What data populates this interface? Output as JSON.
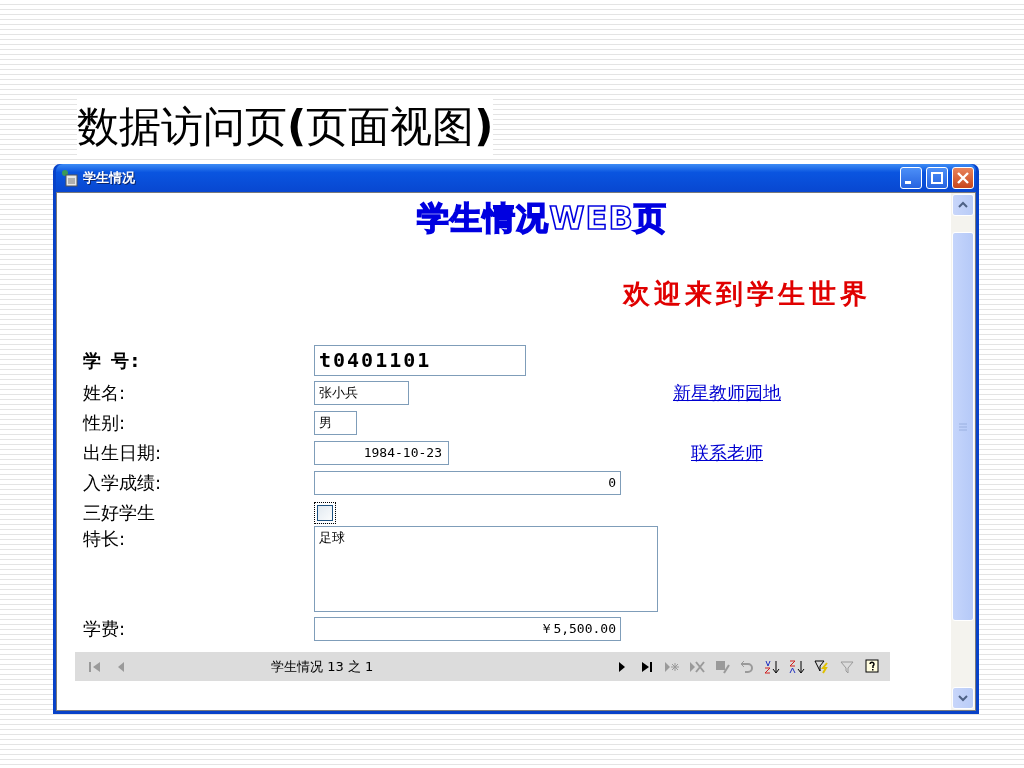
{
  "slide_title": "数据访问页**(**页面视图**)**",
  "window": {
    "title": "学生情况",
    "heading": "学生情况WEB页",
    "subheading": "欢迎来到学生世界"
  },
  "fields": [
    {
      "label": "学 号:",
      "kind": "text",
      "emphasized": true,
      "value": "t0401101"
    },
    {
      "label": "姓名:",
      "kind": "text",
      "emphasized": false,
      "value": "张小兵",
      "link": "新星教师园地"
    },
    {
      "label": "性别:",
      "kind": "text",
      "emphasized": false,
      "value": "男"
    },
    {
      "label": "出生日期:",
      "kind": "date",
      "emphasized": false,
      "value": "1984-10-23",
      "link": "联系老师"
    },
    {
      "label": "入学成绩:",
      "kind": "number",
      "emphasized": false,
      "value": "0"
    },
    {
      "label": "三好学生",
      "kind": "checkbox",
      "emphasized": false,
      "checked": false
    },
    {
      "label": "特长:",
      "kind": "textarea",
      "emphasized": false,
      "value": "足球"
    },
    {
      "label": "学费:",
      "kind": "number",
      "emphasized": false,
      "value": "￥5,500.00"
    }
  ],
  "navigation": {
    "record_text": "学生情况 13 之 1",
    "buttons_left": [
      {
        "kind": "first",
        "disabled": true
      },
      {
        "kind": "prev",
        "disabled": true
      }
    ],
    "buttons_right": [
      {
        "kind": "next",
        "disabled": false
      },
      {
        "kind": "last",
        "disabled": false
      },
      {
        "kind": "new",
        "disabled": true
      },
      {
        "kind": "delete",
        "disabled": true
      },
      {
        "kind": "save",
        "disabled": true
      },
      {
        "kind": "undo",
        "disabled": true
      },
      {
        "kind": "sort-asc",
        "disabled": false
      },
      {
        "kind": "sort-desc",
        "disabled": false
      },
      {
        "kind": "filter-selection",
        "disabled": false
      },
      {
        "kind": "filter",
        "disabled": true
      },
      {
        "kind": "help",
        "disabled": false
      }
    ]
  }
}
